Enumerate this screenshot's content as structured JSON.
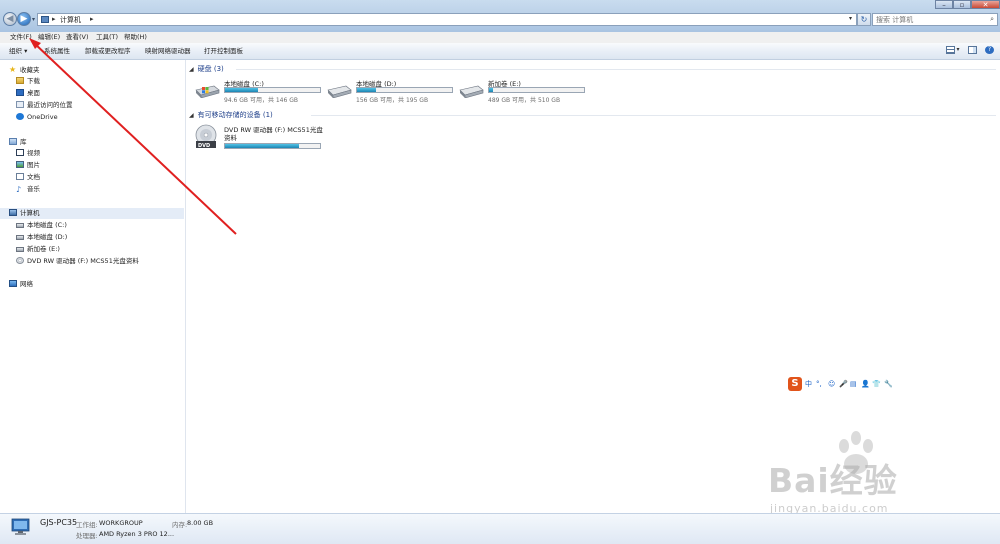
{
  "titlebar": {
    "address_text": "计算机",
    "search_placeholder": "搜索 计算机"
  },
  "menu": {
    "items": [
      "文件(F)",
      "编辑(E)",
      "查看(V)",
      "工具(T)",
      "帮助(H)"
    ]
  },
  "toolbar": {
    "items": [
      "组织 ▾",
      "系统属性",
      "卸载或更改程序",
      "映射网络驱动器",
      "打开控制面板"
    ]
  },
  "navpane": {
    "favorites": {
      "label": "收藏夹",
      "items": [
        "下载",
        "桌面",
        "最近访问的位置",
        "OneDrive"
      ]
    },
    "libraries": {
      "label": "库",
      "items": [
        "视频",
        "图片",
        "文档",
        "音乐"
      ]
    },
    "computer": {
      "label": "计算机",
      "items": [
        "本地磁盘 (C:)",
        "本地磁盘 (D:)",
        "新加卷 (E:)",
        "DVD RW 驱动器 (F:) MCS51光盘资料"
      ]
    },
    "network": {
      "label": "网络"
    }
  },
  "content": {
    "hard_drives_title": "硬盘 (3)",
    "drives": [
      {
        "name": "本地磁盘 (C:)",
        "free": "94.6 GB 可用，共 146 GB",
        "used_fraction": 0.35
      },
      {
        "name": "本地磁盘 (D:)",
        "free": "156 GB 可用，共 195 GB",
        "used_fraction": 0.2
      },
      {
        "name": "新加卷 (E:)",
        "free": "489 GB 可用，共 510 GB",
        "used_fraction": 0.04
      }
    ],
    "removable_title": "有可移动存储的设备 (1)",
    "dvd": {
      "name_line1": "DVD RW 驱动器 (F:) MCS51光盘",
      "name_line2": "资料",
      "used_fraction": 0.78,
      "icon_label": "DVD"
    }
  },
  "details": {
    "pc_name": "GJS-PC35",
    "workgroup_label": "工作组:",
    "workgroup": "WORKGROUP",
    "memory_label": "内存:",
    "memory": "8.00 GB",
    "processor_label": "处理器:",
    "processor": "AMD Ryzen 3 PRO 12..."
  },
  "ime": {
    "logo": "S",
    "items": [
      "中",
      "°,",
      "☺",
      "🎤",
      "▤",
      "👤",
      "👕",
      "🔧"
    ]
  },
  "watermark": {
    "text": "Bai经验",
    "url": "jingyan.baidu.com"
  },
  "colors": {
    "accent": "#1e3f8a",
    "annotation": "#e02020",
    "drive_fill": "#1c84b3"
  }
}
